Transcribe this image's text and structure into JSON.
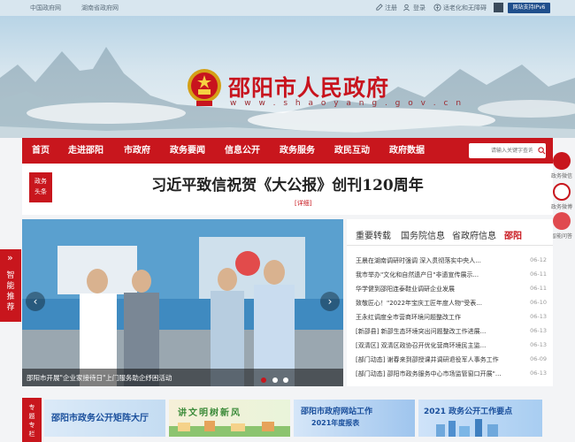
{
  "top_bar": {
    "links": [
      "中国政府网",
      "湖南省政府网"
    ],
    "register": "注册",
    "login": "登录",
    "accessibility": "适老化和无障碍",
    "ipv6": "网站支持IPv6"
  },
  "header": {
    "title": "邵阳市人民政府",
    "url": "w w w . s h a o y a n g . g o v . c n"
  },
  "nav": {
    "items": [
      "首页",
      "走进邵阳",
      "市政府",
      "政务要闻",
      "信息公开",
      "政务服务",
      "政民互动",
      "政府数据"
    ],
    "search_placeholder": "请输入关键字查询"
  },
  "headline": {
    "badge_line1": "政务",
    "badge_line2": "头条",
    "title": "习近平致信祝贺《大公报》创刊120周年",
    "detail": "[详细]"
  },
  "side_float": {
    "items": [
      "政务微信",
      "政务微博",
      "智能问答"
    ]
  },
  "left_tag": {
    "text": "智能推荐"
  },
  "slider": {
    "caption": "邵阳市开展\"企业家接待日\"上门服务助企纾困活动"
  },
  "news": {
    "tabs": [
      "重要转载",
      "国务院信息",
      "省政府信息",
      "邵阳"
    ],
    "active_tab": "邵阳",
    "items": [
      {
        "title": "王晨在湖南调研时强调 深入贯彻落实中央人...",
        "date": "06-12"
      },
      {
        "title": "我市举办\"文化和自然遗产日\"非遗宣传展示...",
        "date": "06-11"
      },
      {
        "title": "华学健到邵阳连泰鞋业调研企业发展",
        "date": "06-11"
      },
      {
        "title": "致敬匠心！\"2022年宝庆工匠年度人物\"受表...",
        "date": "06-10"
      },
      {
        "title": "王永红调度全市营商环境问题整改工作",
        "date": "06-13"
      },
      {
        "title": "[新邵县] 新邵生态环境突出问题整改工作进展...",
        "date": "06-13"
      },
      {
        "title": "[双清区] 双清区政协召开优化营商环境民主监...",
        "date": "06-13"
      },
      {
        "title": "[部门动态] 谢春来到邵授课并调研退役军人事务工作",
        "date": "06-09"
      },
      {
        "title": "[部门动态] 邵阳市政务服务中心市场监管窗口开展\"...",
        "date": "06-13"
      }
    ]
  },
  "topics": {
    "tag": "专题专栏",
    "items": [
      {
        "title": "邵阳市政务公开矩阵大厅"
      },
      {
        "title": "讲文明树新风"
      },
      {
        "title": "邵阳市政府网站工作",
        "sub": "2021年度报表"
      },
      {
        "title": "2021 政务公开工作要点"
      }
    ]
  }
}
